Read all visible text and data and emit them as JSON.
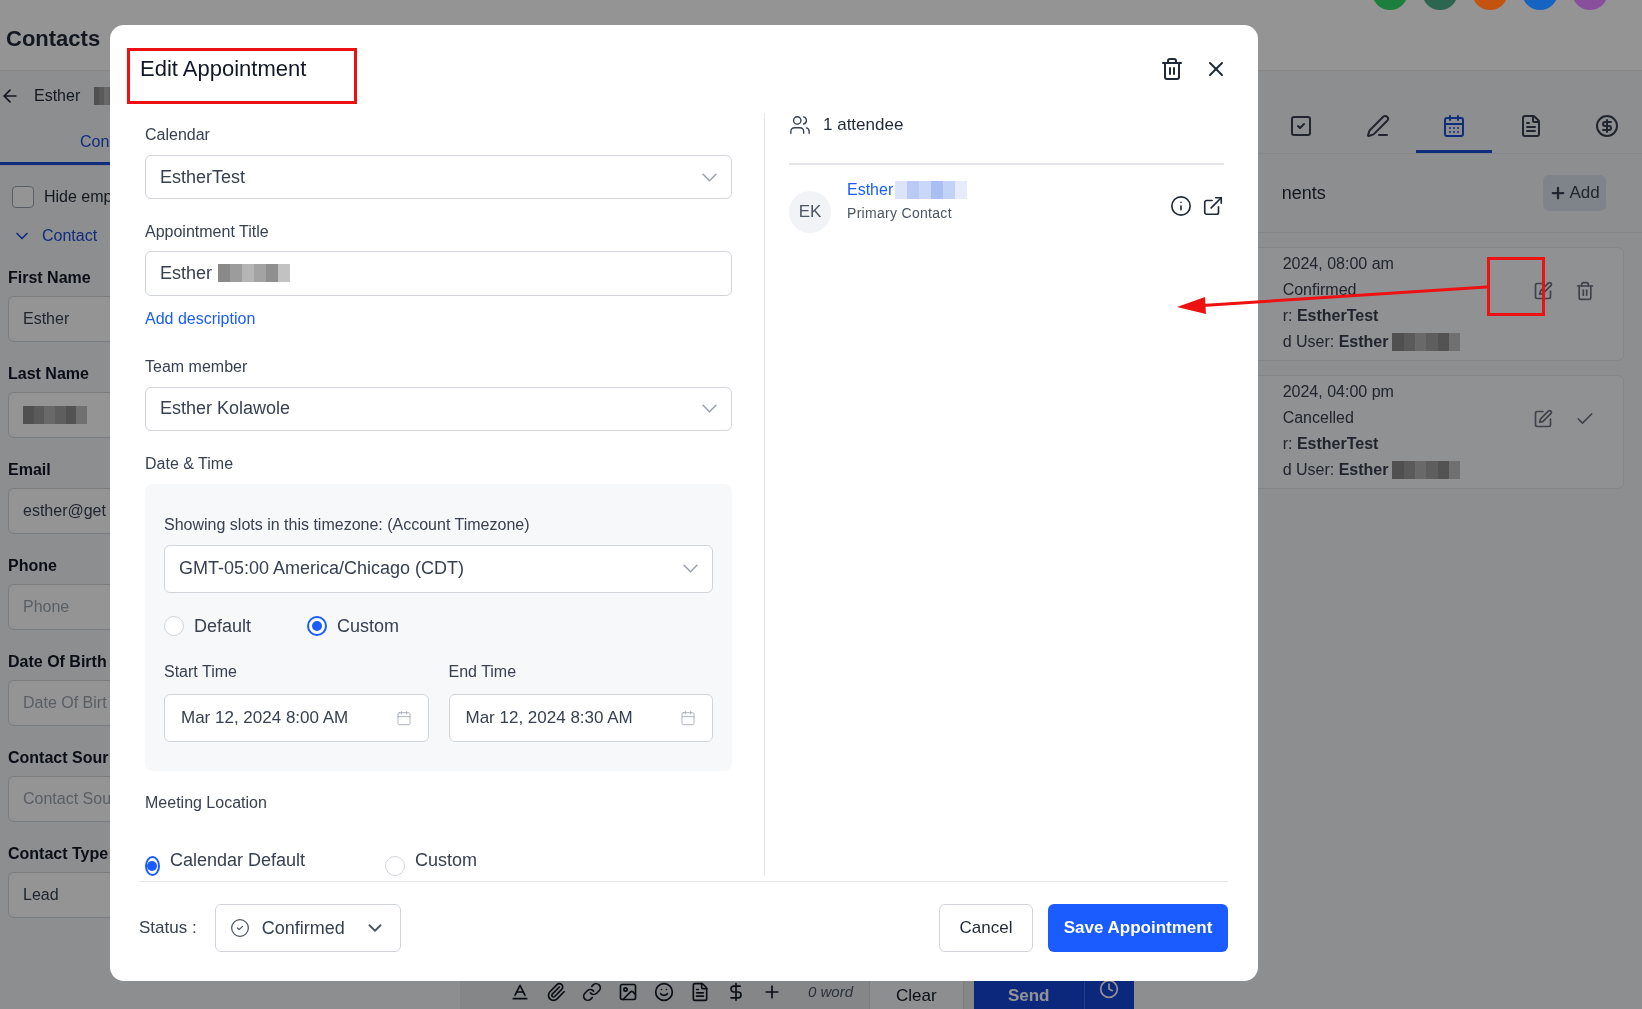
{
  "background": {
    "header": {
      "title": "Contacts",
      "avatars": [
        {
          "color": "#1d7f3d"
        },
        {
          "color": "#2c6650"
        },
        {
          "color": "#c2540f"
        },
        {
          "color": "#1664c2"
        },
        {
          "color": "#8a4f9c"
        }
      ]
    },
    "left_panel": {
      "back_label": "Esther",
      "tab": "Con",
      "hide_empty": {
        "label": "Hide emp",
        "checked": false
      },
      "section": "Contact",
      "fields": [
        {
          "label": "First Name",
          "kind": "value",
          "text": "Esther"
        },
        {
          "label": "Last Name",
          "kind": "redacted"
        },
        {
          "label": "Email",
          "kind": "value",
          "text": "esther@get"
        },
        {
          "label": "Phone",
          "kind": "placeholder",
          "text": "Phone"
        },
        {
          "label": "Date Of Birth",
          "kind": "placeholder",
          "text": "Date Of Birt"
        },
        {
          "label": "Contact Sour",
          "kind": "placeholder",
          "text": "Contact Sou"
        },
        {
          "label": "Contact Type",
          "kind": "value",
          "text": "Lead"
        }
      ]
    },
    "composer": {
      "word_count": "0 word",
      "clear": "Clear",
      "send": "Send"
    },
    "right_panel": {
      "tabs": [
        {
          "selected": false
        },
        {
          "selected": false
        },
        {
          "selected": true
        },
        {
          "selected": false
        },
        {
          "selected": false
        }
      ],
      "section_title": "nents",
      "add_button": "Add",
      "appointments": [
        {
          "date": "2024, 08:00 am",
          "status": "Confirmed",
          "calendar_prefix": "r:",
          "calendar": "EstherTest",
          "user_prefix": "d User:",
          "user": "Esther",
          "kind": "delete"
        },
        {
          "date": "2024, 04:00 pm",
          "status": "Cancelled",
          "calendar_prefix": "r:",
          "calendar": "EstherTest",
          "user_prefix": "d User:",
          "user": "Esther",
          "kind": "confirm"
        }
      ]
    }
  },
  "modal": {
    "title": "Edit Appointment",
    "calendar": {
      "label": "Calendar",
      "value": "EstherTest"
    },
    "appointment_title": {
      "label": "Appointment Title",
      "value": "Esther"
    },
    "add_description": "Add description",
    "team_member": {
      "label": "Team member",
      "value": "Esther Kolawole"
    },
    "date_time": {
      "label": "Date & Time",
      "timezone_label": "Showing slots in this timezone: (Account Timezone)",
      "timezone": "GMT-05:00 America/Chicago (CDT)",
      "modes": [
        {
          "label": "Default",
          "selected": false
        },
        {
          "label": "Custom",
          "selected": true
        }
      ],
      "start": {
        "label": "Start Time",
        "value": "Mar 12, 2024 8:00 AM"
      },
      "end": {
        "label": "End Time",
        "value": "Mar 12, 2024 8:30 AM"
      }
    },
    "meeting_location": {
      "label": "Meeting Location",
      "options": [
        {
          "label": "Calendar Default",
          "selected": true
        },
        {
          "label": "Custom",
          "selected": false
        }
      ]
    },
    "attendees": {
      "count_label": "1 attendee",
      "list": [
        {
          "initials": "EK",
          "name": "Esther",
          "role": "Primary Contact"
        }
      ]
    },
    "status": {
      "label": "Status :",
      "value": "Confirmed"
    },
    "cancel": "Cancel",
    "save": "Save Appointment"
  }
}
